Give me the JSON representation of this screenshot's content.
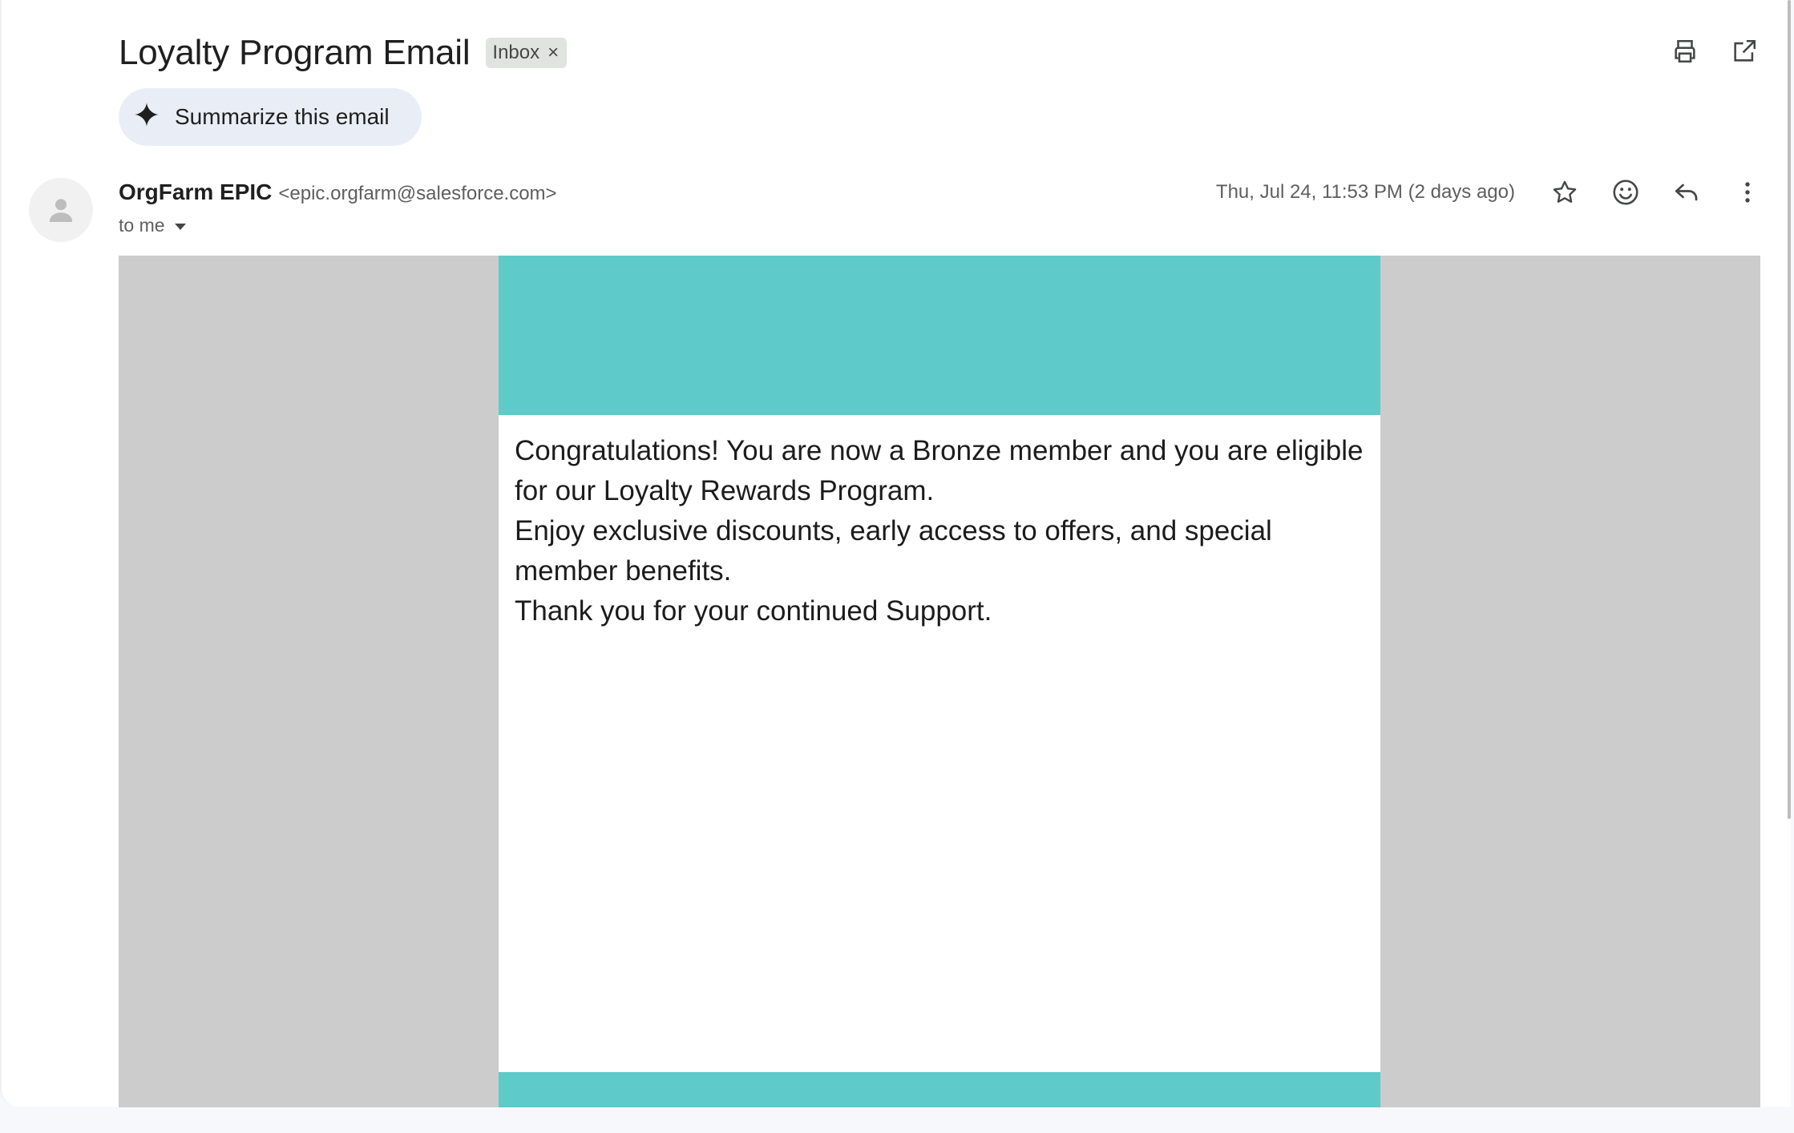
{
  "email": {
    "subject": "Loyalty Program Email",
    "label": "Inbox",
    "label_remove": "×",
    "summarize_label": "Summarize this email",
    "sender_name": "OrgFarm EPIC",
    "sender_email": "<epic.orgfarm@salesforce.com>",
    "to_text": "to me",
    "date": "Thu, Jul 24, 11:53 PM (2 days ago)"
  },
  "body": {
    "paragraphs": [
      "Congratulations! You are now a Bronze member and you are eligible for our Loyalty Rewards Program.",
      "Enjoy exclusive discounts, early access to offers, and special member benefits.",
      "Thank you for your continued Support."
    ]
  },
  "icons": {
    "print": "print-icon",
    "open_new_window": "open-in-new-window-icon",
    "sparkle": "sparkle-icon",
    "avatar": "person-icon",
    "star": "star-icon",
    "emoji": "emoji-icon",
    "reply": "reply-icon",
    "more": "more-vert-icon"
  },
  "colors": {
    "banner": "#5ecaca",
    "body_backdrop": "#cccccc",
    "summarize_bg": "#e9eef6",
    "chip_bg": "#e1e3e1"
  }
}
